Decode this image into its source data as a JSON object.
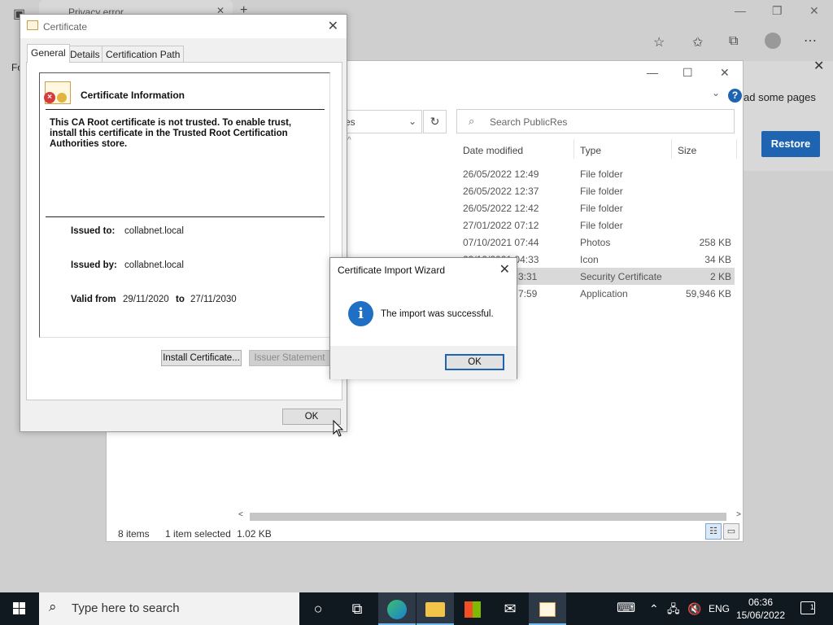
{
  "browser": {
    "tab_title": "Privacy error",
    "fo_label": "Fo",
    "restore_message": "ad some pages",
    "restore_button": "Restore"
  },
  "explorer": {
    "address_fragment": "es",
    "search_placeholder": "Search PublicRes",
    "columns": {
      "date": "Date modified",
      "type": "Type",
      "size": "Size"
    },
    "rows": [
      {
        "date": "26/05/2022 12:49",
        "type": "File folder",
        "size": ""
      },
      {
        "date": "26/05/2022 12:37",
        "type": "File folder",
        "size": ""
      },
      {
        "date": "26/05/2022 12:42",
        "type": "File folder",
        "size": ""
      },
      {
        "date": "27/01/2022 07:12",
        "type": "File folder",
        "size": ""
      },
      {
        "date": "07/10/2021 07:44",
        "type": "Photos",
        "size": "258 KB"
      },
      {
        "date": "23/12/2021 04:33",
        "type": "Icon",
        "size": "34 KB"
      },
      {
        "date": "3:31",
        "type": "Security Certificate",
        "size": "2 KB"
      },
      {
        "date": "7:59",
        "type": "Application",
        "size": "59,946 KB"
      }
    ],
    "status_items": "8 items",
    "status_selected": "1 item selected",
    "status_size": "1.02 KB"
  },
  "certificate": {
    "title": "Certificate",
    "tabs": [
      "General",
      "Details",
      "Certification Path"
    ],
    "info_heading": "Certificate Information",
    "warning": "This CA Root certificate is not trusted. To enable trust, install this certificate in the Trusted Root Certification Authorities store.",
    "issued_to_label": "Issued to:",
    "issued_to": "collabnet.local",
    "issued_by_label": "Issued by:",
    "issued_by": "collabnet.local",
    "valid_from_label": "Valid from",
    "valid_from": "29/11/2020",
    "valid_to_label": "to",
    "valid_to": "27/11/2030",
    "install_button": "Install Certificate...",
    "issuer_button": "Issuer Statement",
    "ok_button": "OK"
  },
  "wizard": {
    "title": "Certificate Import Wizard",
    "message": "The import was successful.",
    "ok_button": "OK",
    "info_glyph": "i"
  },
  "taskbar": {
    "search_placeholder": "Type here to search",
    "language": "ENG",
    "time": "06:36",
    "date": "15/06/2022",
    "notification_count": "1"
  }
}
